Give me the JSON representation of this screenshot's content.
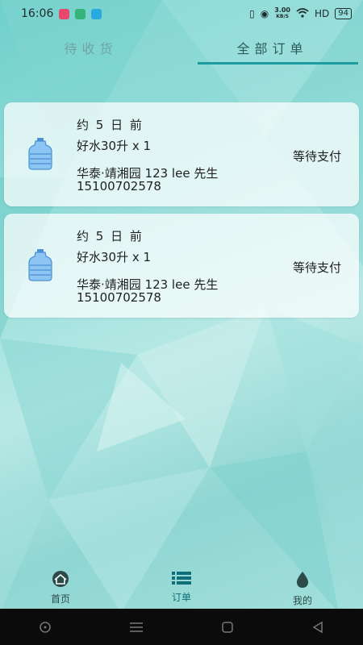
{
  "status_bar": {
    "time": "16:06",
    "net_speed_value": "3.00",
    "net_speed_unit": "KB/S",
    "network_label": "HD",
    "battery": "94"
  },
  "tabs": [
    {
      "label": "待收货",
      "active": false
    },
    {
      "label": "全部订单",
      "active": true
    }
  ],
  "orders": [
    {
      "time": "约 5 日 前",
      "product": "好水30升 x 1",
      "address": "华泰·靖湘园  123 lee 先生",
      "phone": "15100702578",
      "status": "等待支付",
      "icon": "water-bottle-icon"
    },
    {
      "time": "约 5 日 前",
      "product": "好水30升 x 1",
      "address": "华泰·靖湘园  123 lee 先生",
      "phone": "15100702578",
      "status": "等待支付",
      "icon": "water-bottle-icon"
    }
  ],
  "bottom_nav": [
    {
      "label": "首页",
      "icon": "home-icon",
      "active": false
    },
    {
      "label": "订单",
      "icon": "list-icon",
      "active": true
    },
    {
      "label": "我的",
      "icon": "drop-icon",
      "active": false
    }
  ],
  "colors": {
    "accent": "#1d9ba0",
    "background": "#8fd6d2"
  }
}
